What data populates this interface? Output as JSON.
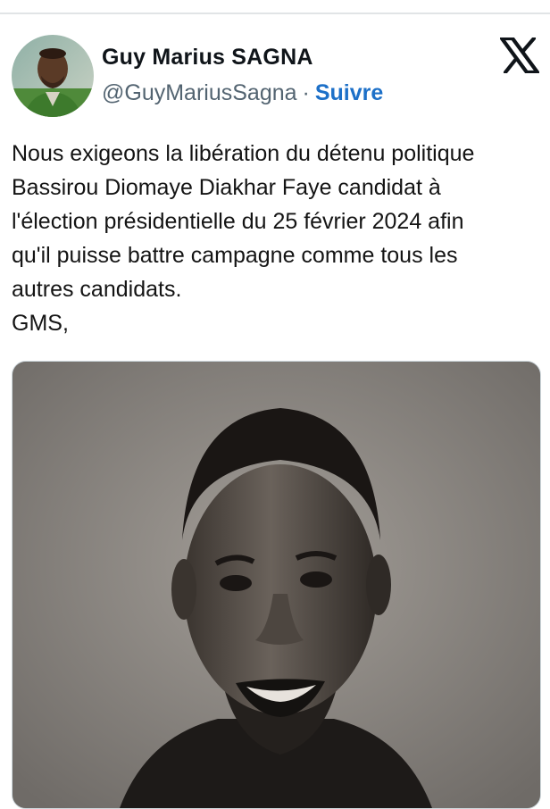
{
  "author": {
    "name": "Guy Marius SAGNA",
    "handle": "@GuyMariusSagna",
    "separator": "·",
    "follow_label": "Suivre"
  },
  "brand": {
    "icon": "x-logo-icon"
  },
  "tweet": {
    "text": "Nous exigeons la libération du détenu politique\nBassirou Diomaye Diakhar Faye candidat à\nl'élection présidentielle du 25 février 2024 afin\nqu'il puisse battre campagne comme tous les\nautres candidats.\nGMS,"
  },
  "colors": {
    "follow": "#1d70c8",
    "handle": "#536471",
    "divider": "#e1e4e6"
  }
}
